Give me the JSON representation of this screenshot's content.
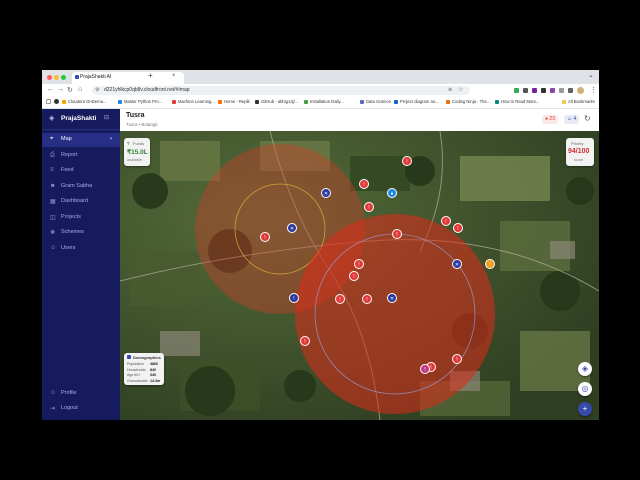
{
  "browser": {
    "tab_title": "PrajaShakti AI",
    "tab_close": "×",
    "new_tab": "+",
    "tab_menu": "⌄",
    "url": "d221yhlkcp0qb8v.cloudfront.net/#/map",
    "nav_back": "←",
    "nav_forward": "→",
    "nav_reload": "↻",
    "nav_home": "⌂",
    "site_info": "⚙",
    "zoom_icon": "⊕",
    "star_icon": "☆",
    "menu_icon": "⋮",
    "window_dots": [
      "#ff5f57",
      "#febc2e",
      "#28c840"
    ],
    "extension_colors": [
      "#34a853",
      "#555555",
      "#7b1fa2",
      "#333333",
      "#8e44ad",
      "#999999",
      "#5f6368"
    ],
    "profile_avatar_color": "#d0b07a",
    "bookmarks": [
      {
        "label": "Cloudera OnDema...",
        "color": "#f4a300"
      },
      {
        "label": "Master Python Pro...",
        "color": "#1e88e5"
      },
      {
        "label": "Machine Learning...",
        "color": "#e53935"
      },
      {
        "label": "Home - Replit",
        "color": "#ff6d00"
      },
      {
        "label": "GitHub - abhig13j/...",
        "color": "#333333"
      },
      {
        "label": "Installation Daily...",
        "color": "#43a047"
      },
      {
        "label": "Data Science",
        "color": "#5c6bc0"
      },
      {
        "label": "Project diagram an...",
        "color": "#1565c0"
      },
      {
        "label": "Coding Ninja - The...",
        "color": "#ef6c00"
      },
      {
        "label": "How to Read More...",
        "color": "#00897b"
      }
    ],
    "all_bookmarks": "All Bookmarks"
  },
  "sidebar": {
    "app_name": "PrajaShakti",
    "logo_icon": "◈",
    "collapse_icon": "⊟",
    "items": [
      {
        "label": "Map",
        "icon": "⌖",
        "active": true,
        "indicator": "›"
      },
      {
        "label": "Report",
        "icon": "⎙",
        "active": false
      },
      {
        "label": "Feed",
        "icon": "≡",
        "active": false
      },
      {
        "label": "Gram Sabha",
        "icon": "⚑",
        "active": false
      },
      {
        "label": "Dashboard",
        "icon": "▦",
        "active": false
      },
      {
        "label": "Projects",
        "icon": "◫",
        "active": false
      },
      {
        "label": "Schemes",
        "icon": "❖",
        "active": false
      },
      {
        "label": "Users",
        "icon": "☺",
        "active": false
      }
    ],
    "profile_label": "Profile",
    "profile_icon": "☺",
    "logout_label": "Logout",
    "logout_icon": "⇥"
  },
  "header": {
    "title": "Tusra",
    "subtitle": "Tusra • Bolangir",
    "alert_count": "23",
    "alert_color": "#e53935",
    "users_count": "4",
    "users_color": "#3949ab",
    "refresh_icon": "↻"
  },
  "map": {
    "budget_card": {
      "label": "Funds",
      "value": "₹15.0L",
      "sub": "available",
      "icon": "₹"
    },
    "score_card": {
      "label": "Priority",
      "value": "94/100",
      "sub": "score"
    },
    "demographics": {
      "title": "Demographics",
      "rows": [
        {
          "label": "Population",
          "value": "4860"
        },
        {
          "label": "Households",
          "value": "840"
        },
        {
          "label": "Age 60+",
          "value": "340"
        },
        {
          "label": "Groundwater",
          "value": "14.3m"
        }
      ]
    },
    "layers_icon": "◈",
    "locate_icon": "◎",
    "add_icon": "+",
    "pin_colors": {
      "red": "#e23a3a",
      "blue": "#2b3a9e",
      "orange": "#f19a1b",
      "brightblue": "#1e88e5",
      "pink": "#c0398a"
    },
    "pins": [
      {
        "glyph": "!",
        "tone": "red"
      },
      {
        "glyph": "✕",
        "tone": "blue"
      },
      {
        "glyph": "!",
        "tone": "red"
      },
      {
        "glyph": "●",
        "tone": "brightblue"
      },
      {
        "glyph": "!",
        "tone": "red"
      },
      {
        "glyph": "!",
        "tone": "red"
      },
      {
        "glyph": "!",
        "tone": "red"
      },
      {
        "glyph": "!",
        "tone": "red"
      },
      {
        "glyph": "✕",
        "tone": "blue"
      },
      {
        "glyph": "✕",
        "tone": "blue"
      },
      {
        "glyph": "!",
        "tone": "orange"
      },
      {
        "glyph": "!",
        "tone": "red"
      },
      {
        "glyph": "!",
        "tone": "red"
      },
      {
        "glyph": "!",
        "tone": "red"
      },
      {
        "glyph": "!",
        "tone": "red"
      },
      {
        "glyph": "!",
        "tone": "red"
      },
      {
        "glyph": "✕",
        "tone": "blue"
      },
      {
        "glyph": "!",
        "tone": "blue"
      },
      {
        "glyph": "!",
        "tone": "red"
      },
      {
        "glyph": "!",
        "tone": "red"
      },
      {
        "glyph": "!",
        "tone": "red"
      },
      {
        "glyph": "!",
        "tone": "pink"
      }
    ]
  }
}
